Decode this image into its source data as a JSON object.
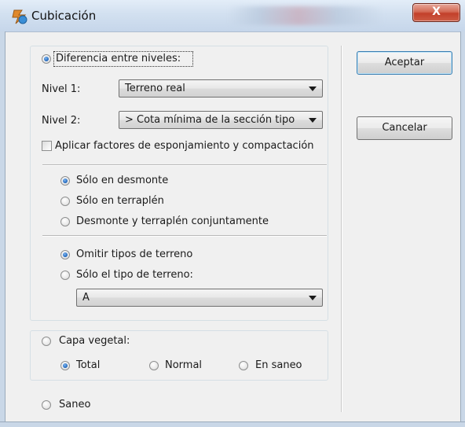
{
  "window": {
    "title": "Cubicación",
    "close_label": "X"
  },
  "icons": {
    "app": "app-icon",
    "close": "close-icon",
    "dropdown": "chevron-down-icon"
  },
  "levels": {
    "difference_label": "Diferencia entre niveles:",
    "nivel1_label": "Nivel 1:",
    "nivel1_value": "Terreno real",
    "nivel2_label": "Nivel 2:",
    "nivel2_value": "> Cota mínima de la sección tipo",
    "apply_factors_label": "Aplicar factores de esponjamiento y compactación"
  },
  "scope": {
    "solo_desmonte": "Sólo en desmonte",
    "solo_terraplen": "Sólo en terraplén",
    "conjunto": "Desmonte y terraplén conjuntamente"
  },
  "terrain": {
    "omitir": "Omitir tipos de terreno",
    "solo_tipo": "Sólo el tipo de terreno:",
    "tipo_value": "A"
  },
  "capa": {
    "label": "Capa vegetal:",
    "total": "Total",
    "normal": "Normal",
    "saneo": "En saneo"
  },
  "saneo_label": "Saneo",
  "buttons": {
    "accept": "Aceptar",
    "cancel": "Cancelar"
  },
  "state": {
    "difference_selected": true,
    "apply_factors_checked": false,
    "scope_selected": "solo_desmonte",
    "terrain_selected": "omitir",
    "capa_selected": false,
    "capa_option_selected": "total",
    "saneo_selected": false
  },
  "colors": {
    "radio_dot": "#2a6fc2",
    "close_button": "#c2402a",
    "default_button_border": "#3c7fb1"
  }
}
